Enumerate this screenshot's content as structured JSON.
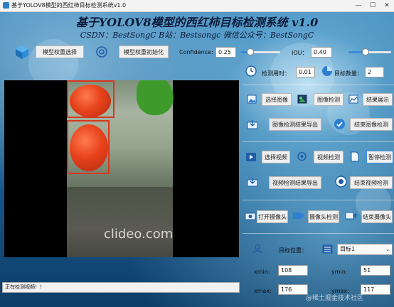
{
  "window": {
    "title": "基于YOLOV8模型的西红柿目标检测系统v1.0",
    "minimize": "—",
    "maximize": "☐",
    "close": "✕"
  },
  "header": {
    "title": "基于YOLOV8模型的西红柿目标检测系统 v1.0",
    "subtitle": "CSDN：BestSongC   B站：Bestsongc   微信公众号：BestSongC"
  },
  "model": {
    "select_label": "模型权重选择",
    "init_label": "模型权重初始化"
  },
  "params": {
    "confidence_label": "Confidence:",
    "confidence_value": "0.25",
    "confidence_level": 0.25,
    "iou_label": "IOU：",
    "iou_value": "0.40",
    "iou_level": 0.4
  },
  "stats": {
    "time_label": "检测用时：",
    "time_value": "0.01",
    "count_label": "目标数量：",
    "count_value": "2"
  },
  "image_section": {
    "select": "选择图像",
    "detect": "图像检测",
    "show": "结果展示",
    "export": "图像检测结果导出",
    "finish": "结束图像检测"
  },
  "video_section": {
    "select": "选择视频",
    "detect": "视频检测",
    "pause": "暂停检测",
    "export": "视频检测结果导出",
    "finish": "结束视频检测"
  },
  "camera_section": {
    "open": "打开摄像头",
    "detect": "摄像头检测",
    "finish": "结束摄像头"
  },
  "target": {
    "position_label": "目标位置：",
    "selected": "目标1",
    "xmin_label": "xmin:",
    "xmin_value": "108",
    "ymin_label": "ymin:",
    "ymin_value": "51",
    "xmax_label": "xmax:",
    "xmax_value": "176",
    "ymax_label": "ymax:",
    "ymax_value": "117"
  },
  "display": {
    "watermark": "clideo.com"
  },
  "status": {
    "text": "正在检测视频！！"
  },
  "corner_watermark": "@稀土掘金技术社区",
  "colors": {
    "accent": "#3a88d8",
    "box": "#d9361a"
  }
}
